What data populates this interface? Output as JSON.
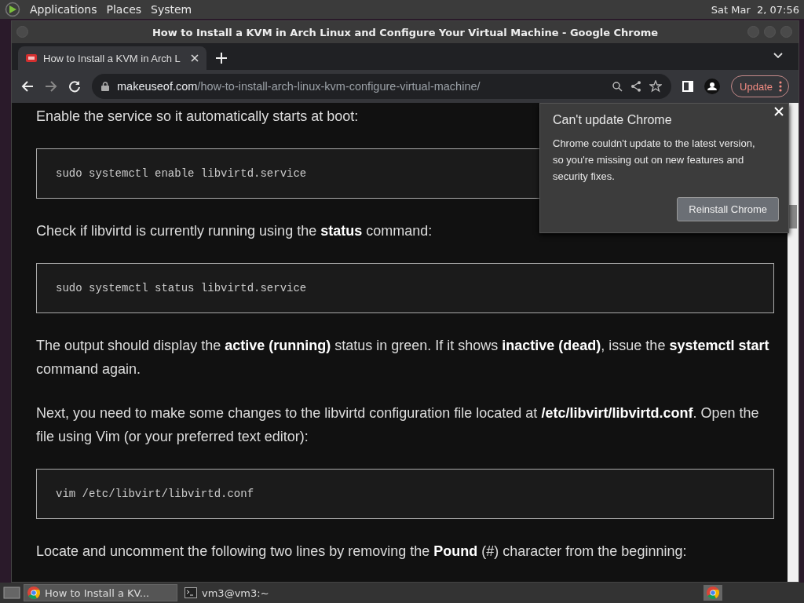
{
  "top_panel": {
    "menus": [
      "Applications",
      "Places",
      "System"
    ],
    "clock": "Sat Mar  2, 07:56"
  },
  "window": {
    "title": "How to Install a KVM in Arch Linux and Configure Your Virtual Machine - Google Chrome",
    "tabs": [
      {
        "label": "How to Install a KVM in Arch L",
        "selected": true
      }
    ],
    "address": {
      "domain": "makeuseof.com",
      "path": "/how-to-install-arch-linux-kvm-configure-virtual-machine/"
    },
    "update_button": "Update"
  },
  "article": [
    {
      "kind": "paragraph",
      "text": "Enable the service so it automatically starts at boot:"
    },
    {
      "kind": "code",
      "text": "sudo systemctl enable libvirtd.service"
    },
    {
      "kind": "paragraph",
      "text": "Check if libvirtd is currently running using the **status** command:"
    },
    {
      "kind": "code",
      "text": "sudo systemctl status libvirtd.service"
    },
    {
      "kind": "paragraph",
      "text": "The output should display the **active (running)** status in green. If it shows **inactive (dead)**, issue the **systemctl start** command again."
    },
    {
      "kind": "paragraph",
      "text": "Next, you need to make some changes to the libvirtd configuration file located at **/etc/libvirt/libvirtd.conf**. Open the file using Vim (or your preferred text editor):"
    },
    {
      "kind": "code",
      "text": "vim /etc/libvirt/libvirtd.conf"
    },
    {
      "kind": "paragraph",
      "text": "Locate and uncomment the following two lines by removing the **Pound** (#) character from the beginning:"
    }
  ],
  "popup": {
    "title": "Can't update Chrome",
    "body": "Chrome couldn't update to the latest version, so you're missing out on new features and security fixes.",
    "button": "Reinstall Chrome"
  },
  "taskbar": [
    {
      "kind": "browser",
      "label": "How to Install a KV...",
      "selected": true
    },
    {
      "kind": "terminal",
      "label": "vm3@vm3:~",
      "selected": false
    }
  ]
}
